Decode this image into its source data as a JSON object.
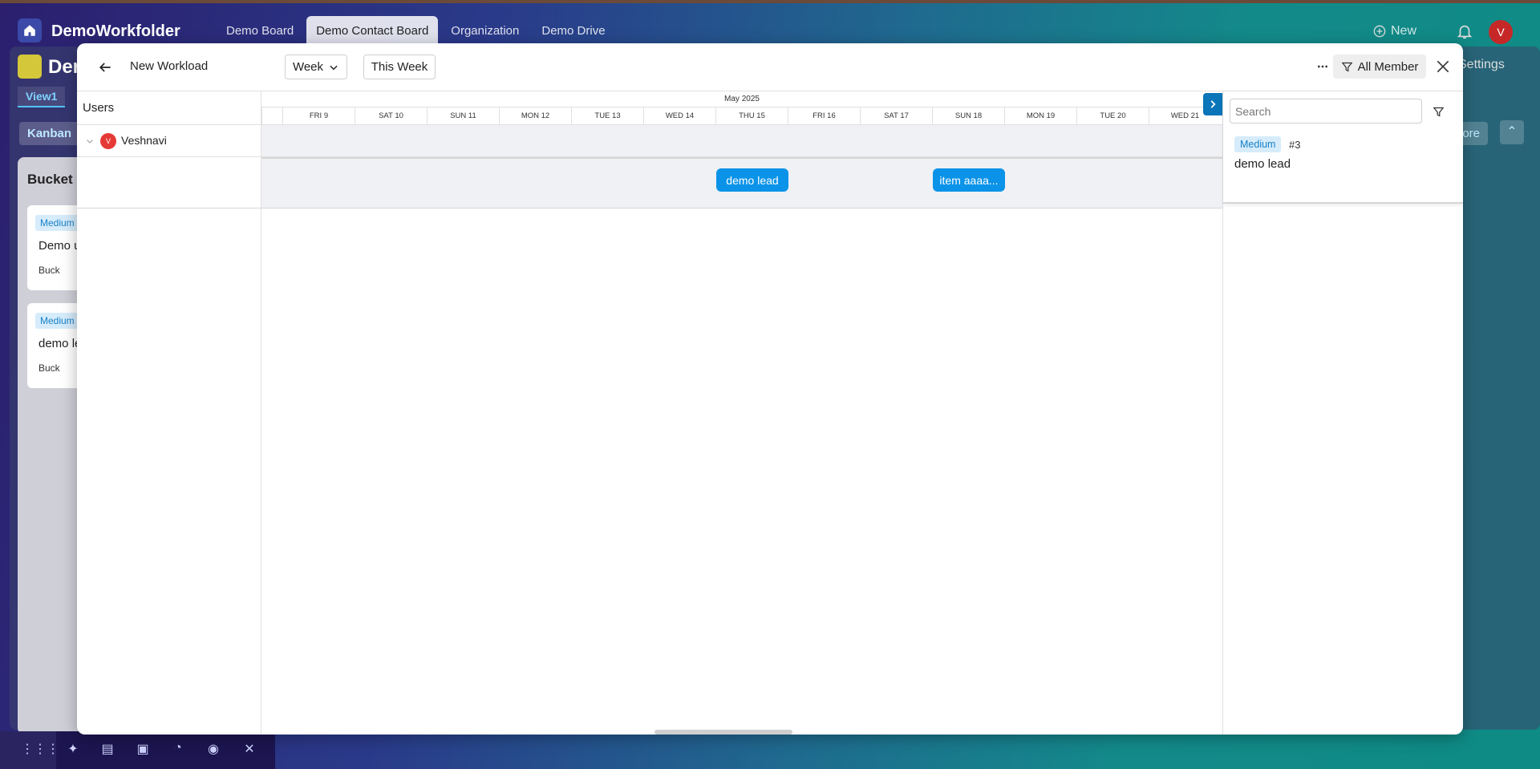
{
  "app": {
    "brand": "DemoWorkfolder",
    "nav": [
      "Demo Board",
      "Demo Contact Board",
      "Organization",
      "Demo Drive"
    ],
    "active_nav_index": 1,
    "new_label": "New",
    "user_initial": "V",
    "board_title": "Der",
    "settings_label": "Settings",
    "view_tab": "View1",
    "kanban_tab": "Kanban",
    "more_label": "lore",
    "bucket_title": "Bucket",
    "cards": [
      {
        "priority": "Medium",
        "title": "Demo u",
        "bucket": "Buck"
      },
      {
        "priority": "Medium",
        "title": "demo le",
        "bucket": "Buck"
      }
    ]
  },
  "modal": {
    "title": "New Workload",
    "week_label": "Week",
    "this_week_label": "This Week",
    "all_member_label": "All Member",
    "users_header": "Users",
    "user": {
      "name": "Veshnavi",
      "initial": "V"
    },
    "month_label": "May 2025",
    "days": [
      "FRI 9",
      "SAT 10",
      "SUN 11",
      "MON 12",
      "TUE 13",
      "WED 14",
      "THU 15",
      "FRI 16",
      "SAT 17",
      "SUN 18",
      "MON 19",
      "TUE 20",
      "WED 21"
    ],
    "tasks": [
      {
        "label": "demo lead",
        "day": "THU 15"
      },
      {
        "label": "item aaaa...",
        "day": "SUN 18"
      }
    ],
    "side": {
      "search_placeholder": "Search",
      "items": [
        {
          "priority": "Medium",
          "number": "#3",
          "title": "demo lead"
        }
      ]
    }
  },
  "colors": {
    "accent": "#0a93e8",
    "priority_bg": "#d6ecfb",
    "priority_text": "#1781c8",
    "user_avatar": "#e53935"
  }
}
